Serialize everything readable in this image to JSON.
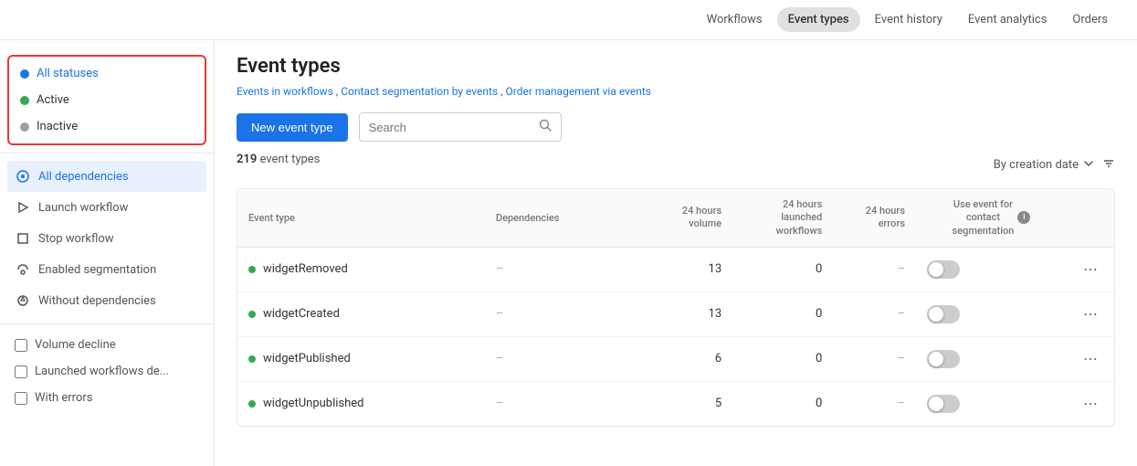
{
  "nav": {
    "items": [
      {
        "label": "Workflows",
        "active": false
      },
      {
        "label": "Event types",
        "active": true
      },
      {
        "label": "Event history",
        "active": false
      },
      {
        "label": "Event analytics",
        "active": false
      },
      {
        "label": "Orders",
        "active": false
      }
    ]
  },
  "sidebar": {
    "statuses": [
      {
        "label": "All statuses",
        "dot": "blue",
        "selected": true
      },
      {
        "label": "Active",
        "dot": "green",
        "selected": false
      },
      {
        "label": "Inactive",
        "dot": "gray",
        "selected": false
      }
    ],
    "dependencies": [
      {
        "label": "All dependencies",
        "icon": "⬡",
        "active": true
      },
      {
        "label": "Launch workflow",
        "icon": "▷",
        "active": false
      },
      {
        "label": "Stop workflow",
        "icon": "☐",
        "active": false
      },
      {
        "label": "Enabled segmentation",
        "icon": "⚹",
        "active": false
      },
      {
        "label": "Without dependencies",
        "icon": "↻",
        "active": false
      }
    ],
    "checkboxes": [
      {
        "label": "Volume decline",
        "checked": false
      },
      {
        "label": "Launched workflows de...",
        "checked": false
      },
      {
        "label": "With errors",
        "checked": false
      }
    ]
  },
  "content": {
    "title": "Event types",
    "breadcrumbs": [
      {
        "label": "Events in workflows",
        "href": "#"
      },
      {
        "label": "Contact segmentation by events",
        "href": "#"
      },
      {
        "label": "Order management via events",
        "href": "#"
      }
    ],
    "new_event_button": "New event type",
    "search_placeholder": "Search",
    "result_count": "219",
    "result_label": "event types",
    "sort_label": "By creation date",
    "table": {
      "headers": [
        {
          "label": "Event type",
          "align": "left"
        },
        {
          "label": "Dependencies",
          "align": "left"
        },
        {
          "label": "24 hours volume",
          "align": "right"
        },
        {
          "label": "24 hours launched workflows",
          "align": "right"
        },
        {
          "label": "24 hours errors",
          "align": "right"
        },
        {
          "label": "Use event for contact segmentation",
          "align": "center"
        }
      ],
      "rows": [
        {
          "name": "widgetRemoved",
          "active": true,
          "dependencies": "–",
          "volume": "13",
          "launched": "0",
          "errors": "–",
          "toggle": false
        },
        {
          "name": "widgetCreated",
          "active": true,
          "dependencies": "–",
          "volume": "13",
          "launched": "0",
          "errors": "–",
          "toggle": false
        },
        {
          "name": "widgetPublished",
          "active": true,
          "dependencies": "–",
          "volume": "6",
          "launched": "0",
          "errors": "–",
          "toggle": false
        },
        {
          "name": "widgetUnpublished",
          "active": true,
          "dependencies": "–",
          "volume": "5",
          "launched": "0",
          "errors": "–",
          "toggle": false
        }
      ]
    }
  }
}
